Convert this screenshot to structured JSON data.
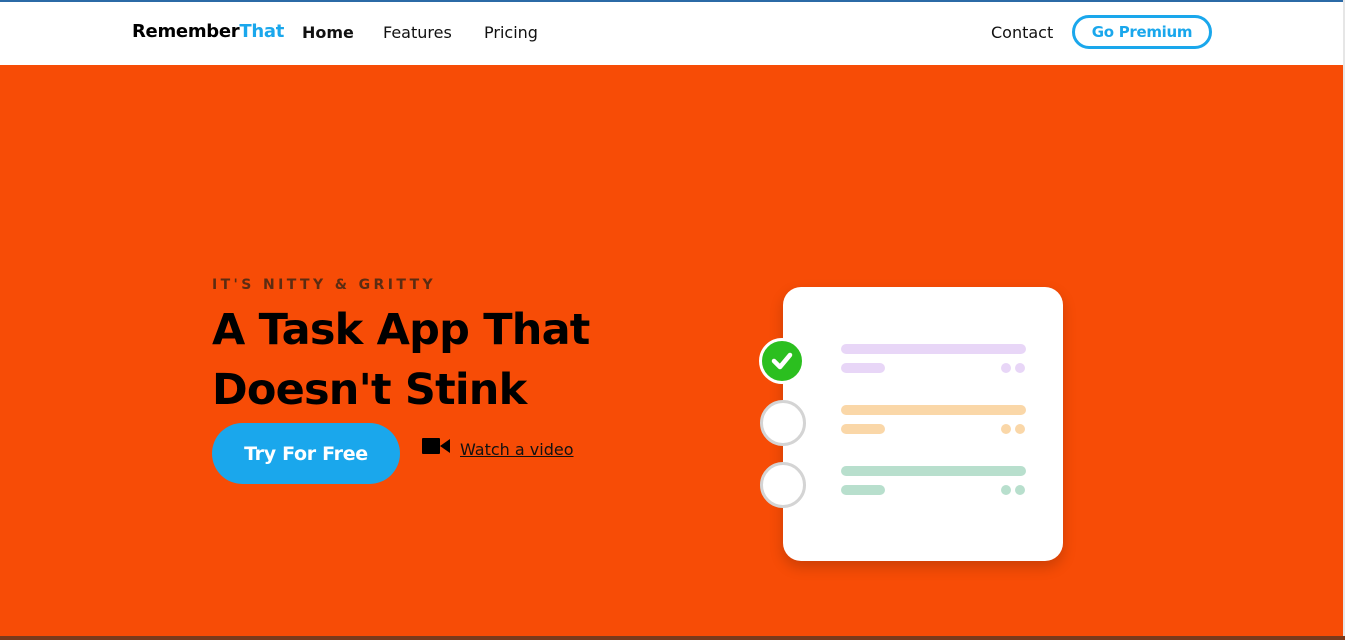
{
  "brand": {
    "part1": "Remember",
    "part2": "That",
    "accent": "#1aa7ec"
  },
  "nav": {
    "home": "Home",
    "features": "Features",
    "pricing": "Pricing",
    "contact": "Contact",
    "premium": "Go Premium"
  },
  "hero": {
    "eyebrow": "IT'S NITTY & GRITTY",
    "headline_line1": "A Task App That",
    "headline_line2": "Doesn't Stink",
    "cta": "Try For Free",
    "video_link": "Watch a video",
    "background": "#f74c06"
  },
  "illustration": {
    "tasks": [
      {
        "done": true,
        "color": "#e8d6f7"
      },
      {
        "done": false,
        "color": "#fad7a8"
      },
      {
        "done": false,
        "color": "#b8dfcd"
      }
    ],
    "check_color": "#2bbf1f"
  }
}
